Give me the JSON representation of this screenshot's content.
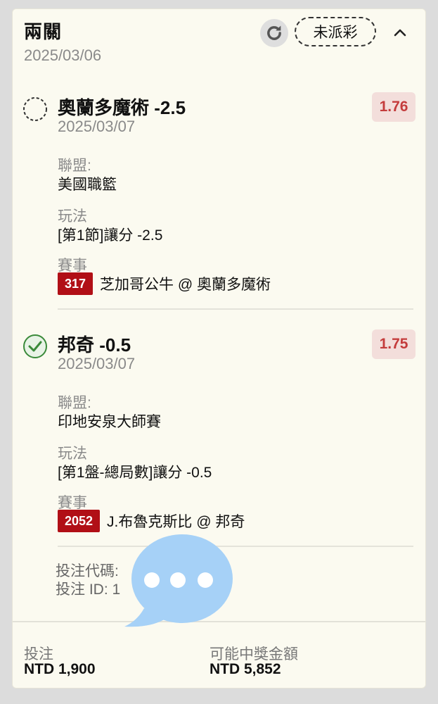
{
  "bet": {
    "title": "兩關",
    "date": "2025/03/06",
    "status_label": "未派彩"
  },
  "selections": [
    {
      "name": "奧蘭多魔術 -2.5",
      "date": "2025/03/07",
      "odds": "1.76",
      "state": "pending",
      "league_label": "聯盟:",
      "league": "美國職籃",
      "market_label": "玩法",
      "market": "[第1節]讓分 -2.5",
      "event_label": "賽事",
      "event_id": "317",
      "event": "芝加哥公牛 @ 奧蘭多魔術"
    },
    {
      "name": "邦奇 -0.5",
      "date": "2025/03/07",
      "odds": "1.75",
      "state": "won",
      "league_label": "聯盟:",
      "league": "印地安泉大師賽",
      "market_label": "玩法",
      "market": "[第1盤-總局數]讓分 -0.5",
      "event_label": "賽事",
      "event_id": "2052",
      "event": "J.布魯克斯比 @ 邦奇"
    }
  ],
  "codes": {
    "bet_code": "投注代碼:",
    "bet_id": "投注 ID: 1"
  },
  "footer": {
    "stake_label": "投注",
    "stake": "NTD 1,900",
    "payout_label": "可能中獎金額",
    "payout": "NTD 5,852"
  },
  "colors": {
    "odds_text": "#c43c3c",
    "odds_bg": "#f3dedb",
    "event_badge": "#b10f16",
    "won_icon": "#3a8a3a",
    "chat_bubble": "#a6d1f7"
  },
  "icons": {
    "refresh": "refresh-icon",
    "collapse": "chevron-up-icon",
    "pending": "pending-circle-icon",
    "won": "check-circle-icon",
    "overlay": "chat-bubble-icon"
  }
}
